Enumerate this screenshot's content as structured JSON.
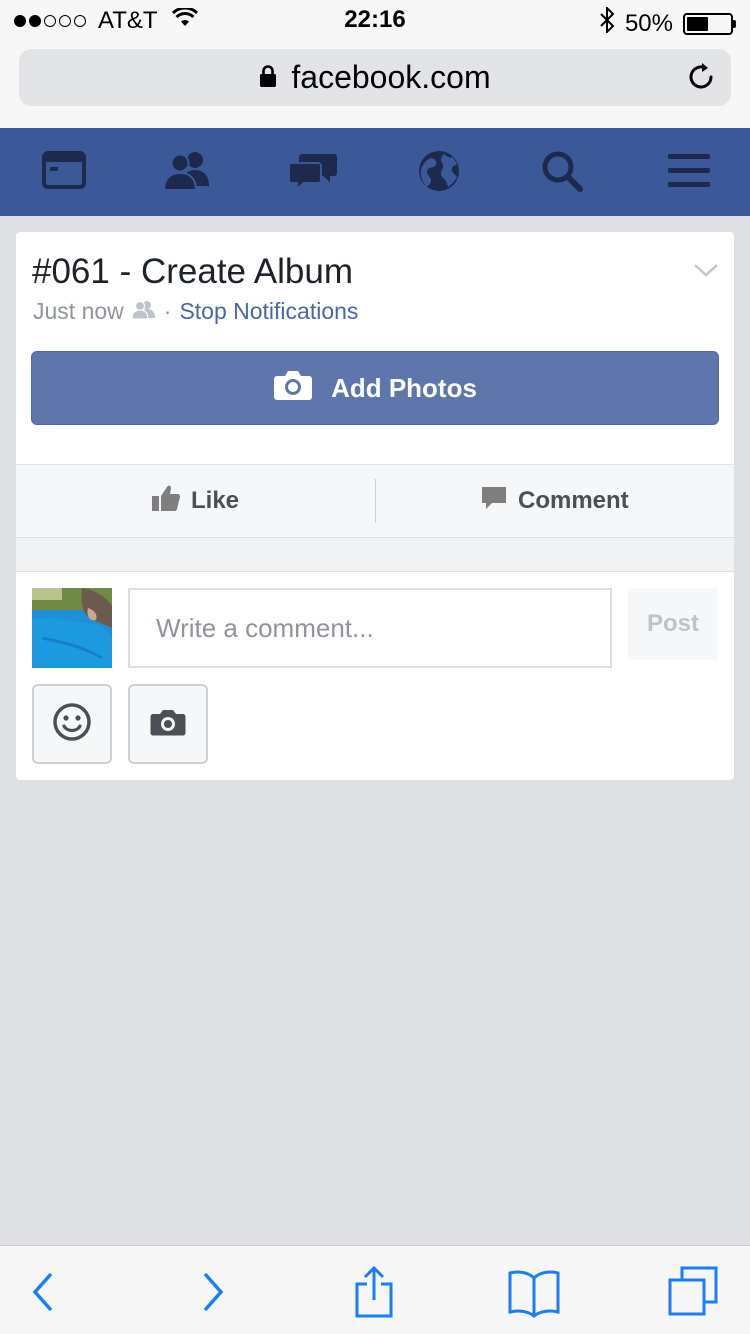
{
  "status_bar": {
    "carrier": "AT&T",
    "time": "22:16",
    "battery_percent": "50%",
    "battery_level": 0.5
  },
  "browser": {
    "url": "facebook.com"
  },
  "fb_nav": {
    "items": [
      "news-feed-icon",
      "friends-icon",
      "messages-icon",
      "notifications-globe-icon",
      "search-icon",
      "menu-icon"
    ],
    "background_color": "#3b5998"
  },
  "post": {
    "title": "#061 - Create Album",
    "timestamp": "Just now",
    "separator": "·",
    "stop_notifications": "Stop Notifications",
    "add_photos_label": "Add Photos"
  },
  "actions": {
    "like_label": "Like",
    "comment_label": "Comment"
  },
  "composer": {
    "placeholder": "Write a comment...",
    "value": "",
    "post_label": "Post"
  },
  "toolbar": {
    "items": [
      "back-icon",
      "forward-icon",
      "share-icon",
      "bookmarks-icon",
      "tabs-icon"
    ],
    "accent_color": "#1a7ef7"
  }
}
